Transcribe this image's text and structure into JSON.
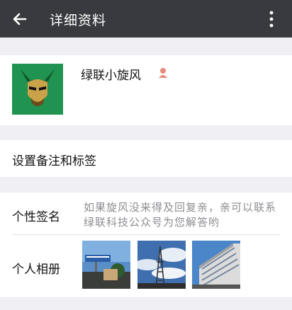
{
  "header": {
    "title": "详细资料"
  },
  "profile": {
    "nickname": "绿联小旋风"
  },
  "remark_row": {
    "label": "设置备注和标签"
  },
  "signature_row": {
    "label": "个性签名",
    "text": "如果旋风没来得及回复亲，亲可以联系绿联科技公众号为您解答哟"
  },
  "album_row": {
    "label": "个人相册"
  },
  "colors": {
    "topbar": "#393a3f",
    "background": "#efeff4",
    "gender_female": "#e88a7a"
  },
  "icons": {
    "back": "arrow-left-icon",
    "more": "more-vertical-icon",
    "gender": "female-gender-icon"
  }
}
